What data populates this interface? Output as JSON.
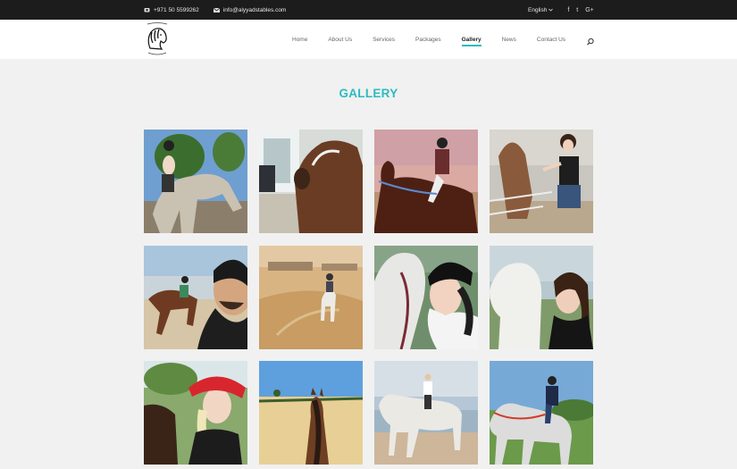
{
  "topbar": {
    "phone": "+971 50 5599262",
    "email": "info@alyyadstables.com",
    "language": "English",
    "social": [
      "f",
      "t",
      "G+"
    ]
  },
  "nav": {
    "items": [
      {
        "label": "Home"
      },
      {
        "label": "About Us"
      },
      {
        "label": "Services"
      },
      {
        "label": "Packages"
      },
      {
        "label": "Gallery",
        "active": true
      },
      {
        "label": "News"
      },
      {
        "label": "Contact Us"
      }
    ]
  },
  "page": {
    "title": "GALLERY"
  },
  "colors": {
    "accent": "#2bbbbf",
    "topbar": "#1c1c1c",
    "background": "#f1f1f1"
  }
}
